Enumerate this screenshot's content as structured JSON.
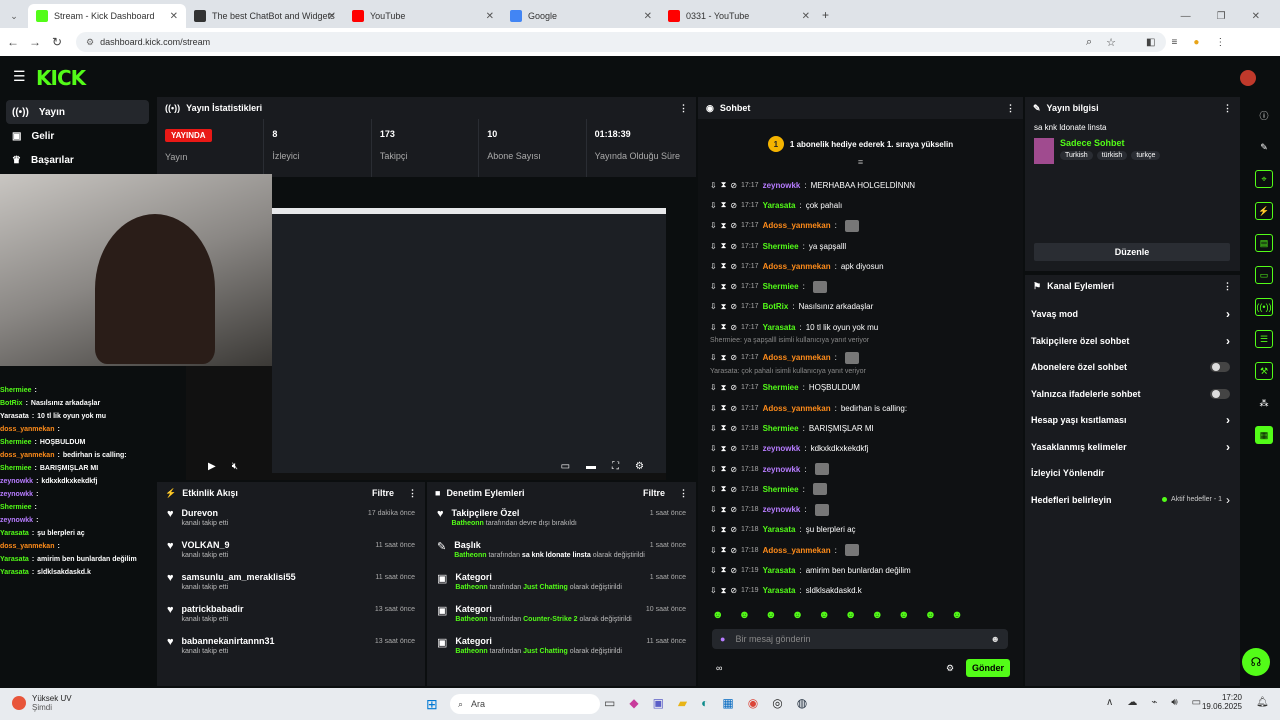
{
  "tabs": [
    {
      "label": "Stream - Kick Dashboard",
      "color": "#53fc18",
      "active": true
    },
    {
      "label": "The best ChatBot and Widgets",
      "color": "#333333"
    },
    {
      "label": "YouTube",
      "color": "#ff0000"
    },
    {
      "label": "Google",
      "color": "#4285f4"
    },
    {
      "label": "0331 - YouTube",
      "color": "#ff0000"
    }
  ],
  "url": "dashboard.kick.com/stream",
  "logo": "KICK",
  "sidebar": {
    "items": [
      {
        "label": "Yayın",
        "icon": "broadcast-icon"
      },
      {
        "label": "Gelir",
        "icon": "money-icon"
      },
      {
        "label": "Başarılar",
        "icon": "trophy-icon"
      }
    ]
  },
  "stats": {
    "title": "Yayın İstatistikleri",
    "live": "YAYINDA",
    "live_label": "Yayın",
    "items": [
      {
        "v": "8",
        "k": "İzleyici"
      },
      {
        "v": "173",
        "k": "Takipçi"
      },
      {
        "v": "10",
        "k": "Abone Sayısı"
      },
      {
        "v": "01:18:39",
        "k": "Yayında Olduğu Süre"
      }
    ]
  },
  "overlay_chat": [
    {
      "u": "Shermiee",
      "c": "#53fc18",
      "m": ""
    },
    {
      "u": "BotRix",
      "c": "#53fc18",
      "m": "Nasılsınız arkadaşlar"
    },
    {
      "u": "Yarasata",
      "c": "#ffffff",
      "m": "10 tl lik oyun yok mu"
    },
    {
      "u": "doss_yanmekan",
      "c": "#ff8c1a",
      "m": ""
    },
    {
      "u": "Shermiee",
      "c": "#53fc18",
      "m": "HOŞBULDUM"
    },
    {
      "u": "doss_yanmekan",
      "c": "#ff8c1a",
      "m": "bedirhan is calling:"
    },
    {
      "u": "Shermiee",
      "c": "#53fc18",
      "m": "BARIŞMIŞLAR MI"
    },
    {
      "u": "zeynowkk",
      "c": "#b77cff",
      "m": "kdkxkdkxkekdkfj"
    },
    {
      "u": "zeynowkk",
      "c": "#b77cff",
      "m": ""
    },
    {
      "u": "Shermiee",
      "c": "#53fc18",
      "m": ""
    },
    {
      "u": "zeynowkk",
      "c": "#b77cff",
      "m": ""
    },
    {
      "u": "Yarasata",
      "c": "#53fc18",
      "m": "şu blerpleri aç"
    },
    {
      "u": "doss_yanmekan",
      "c": "#ff8c1a",
      "m": ""
    },
    {
      "u": "Yarasata",
      "c": "#53fc18",
      "m": "amirim ben bunlardan değilim"
    },
    {
      "u": "Yarasata",
      "c": "#53fc18",
      "m": "sldklsakdaskd.k"
    }
  ],
  "activity": {
    "title": "Etkinlik Akışı",
    "filter": "Filtre",
    "rows": [
      {
        "n": "Durevon",
        "s": "kanalı takip etti",
        "t": "17 dakika önce"
      },
      {
        "n": "VOLKAN_9",
        "s": "kanalı takip etti",
        "t": "11 saat önce"
      },
      {
        "n": "samsunlu_am_meraklisi55",
        "s": "kanalı takip etti",
        "t": "11 saat önce"
      },
      {
        "n": "patrickbabadir",
        "s": "kanalı takip etti",
        "t": "13 saat önce"
      },
      {
        "n": "babannekanirtannn31",
        "s": "kanalı takip etti",
        "t": "13 saat önce"
      }
    ]
  },
  "moderation": {
    "title": "Denetim Eylemleri",
    "filter": "Filtre",
    "rows": [
      {
        "n": "Takipçilere Özel",
        "a": "Batheonn",
        "s": " tarafından devre dışı bırakıldı",
        "h": "",
        "e": "",
        "t": "1 saat önce",
        "icon": "heart-icon"
      },
      {
        "n": "Başlık",
        "a": "Batheonn",
        "s": " tarafından ",
        "h": "sa knk ldonate linsta",
        "e": " olarak değiştirildi",
        "t": "1 saat önce",
        "icon": "pencil-icon"
      },
      {
        "n": "Kategori",
        "a": "Batheonn",
        "s": " tarafından ",
        "h": "Just Chatting",
        "e": " olarak değiştirildi",
        "t": "1 saat önce",
        "icon": "category-icon"
      },
      {
        "n": "Kategori",
        "a": "Batheonn",
        "s": " tarafından ",
        "h": "Counter-Strike 2",
        "e": " olarak değiştirildi",
        "t": "10 saat önce",
        "icon": "category-icon"
      },
      {
        "n": "Kategori",
        "a": "Batheonn",
        "s": " tarafından ",
        "h": "Just Chatting",
        "e": " olarak değiştirildi",
        "t": "11 saat önce",
        "icon": "category-icon"
      }
    ]
  },
  "chat": {
    "title": "Sohbet",
    "pinned": "1 abonelik hediye ederek 1. sıraya yükselin",
    "placeholder": "Bir mesaj gönderin",
    "send": "Gönder",
    "messages": [
      {
        "t": "17:17",
        "u": "zeynowkk",
        "c": "#b77cff",
        "m": "MERHABAA HOLGELDİNNN"
      },
      {
        "t": "17:17",
        "u": "Yarasata",
        "c": "#53fc18",
        "m": "çok pahalı"
      },
      {
        "t": "17:17",
        "u": "Adoss_yanmekan",
        "c": "#ff8c1a",
        "m": ""
      },
      {
        "t": "17:17",
        "u": "Shermiee",
        "c": "#53fc18",
        "m": "ya şapşalll"
      },
      {
        "t": "17:17",
        "u": "Adoss_yanmekan",
        "c": "#ff8c1a",
        "m": "apk diyosun"
      },
      {
        "t": "17:17",
        "u": "Shermiee",
        "c": "#53fc18",
        "m": ""
      },
      {
        "t": "17:17",
        "u": "BotRix",
        "c": "#53fc18",
        "m": "Nasılsınız arkadaşlar"
      },
      {
        "t": "17:17",
        "u": "Yarasata",
        "c": "#53fc18",
        "m": "10 tl lik oyun yok mu"
      },
      {
        "reply": "Shermiee: ya şapşalll isimli kullanıcıya yanıt veriyor"
      },
      {
        "t": "17:17",
        "u": "Adoss_yanmekan",
        "c": "#ff8c1a",
        "m": ""
      },
      {
        "reply": "Yarasata: çok pahalı isimli kullanıcıya yanıt veriyor"
      },
      {
        "t": "17:17",
        "u": "Shermiee",
        "c": "#53fc18",
        "m": "HOŞBULDUM"
      },
      {
        "t": "17:17",
        "u": "Adoss_yanmekan",
        "c": "#ff8c1a",
        "m": "bedirhan is calling:"
      },
      {
        "t": "17:18",
        "u": "Shermiee",
        "c": "#53fc18",
        "m": "BARIŞMIŞLAR MI"
      },
      {
        "t": "17:18",
        "u": "zeynowkk",
        "c": "#b77cff",
        "m": "kdkxkdkxkekdkfj"
      },
      {
        "t": "17:18",
        "u": "zeynowkk",
        "c": "#b77cff",
        "m": ""
      },
      {
        "t": "17:18",
        "u": "Shermiee",
        "c": "#53fc18",
        "m": ""
      },
      {
        "t": "17:18",
        "u": "zeynowkk",
        "c": "#b77cff",
        "m": ""
      },
      {
        "t": "17:18",
        "u": "Yarasata",
        "c": "#53fc18",
        "m": "şu blerpleri aç"
      },
      {
        "t": "17:18",
        "u": "Adoss_yanmekan",
        "c": "#ff8c1a",
        "m": ""
      },
      {
        "t": "17:19",
        "u": "Yarasata",
        "c": "#53fc18",
        "m": "amirim ben bunlardan değilim"
      },
      {
        "t": "17:19",
        "u": "Yarasata",
        "c": "#53fc18",
        "m": "sldklsakdaskd.k"
      }
    ]
  },
  "info": {
    "title": "Yayın bilgisi",
    "stream_title": "sa knk ldonate linsta",
    "category": "Sadece Sohbet",
    "tags": [
      "Turkish",
      "türkish",
      "turkçe"
    ],
    "edit": "Düzenle"
  },
  "channel_actions": {
    "title": "Kanal Eylemleri",
    "rows": [
      {
        "l": "Yavaş mod",
        "k": "chevron"
      },
      {
        "l": "Takipçilere özel sohbet",
        "k": "chevron"
      },
      {
        "l": "Abonelere özel sohbet",
        "k": "toggle"
      },
      {
        "l": "Yalnızca ifadelerle sohbet",
        "k": "toggle"
      },
      {
        "l": "Hesap yaşı kısıtlaması",
        "k": "chevron"
      },
      {
        "l": "Yasaklanmış kelimeler",
        "k": "chevron"
      },
      {
        "l": "İzleyici Yönlendir",
        "k": "none"
      },
      {
        "l": "Hedefleri belirleyin",
        "k": "goal"
      }
    ],
    "goal_text": "Aktif hedefler - 1"
  },
  "taskbar": {
    "weather": "Yüksek UV",
    "weather_sub": "Şimdi",
    "search": "Ara",
    "time": "17:20",
    "date": "19.06.2025"
  },
  "colors": {
    "accent": "#53fc18",
    "panel": "#191b1f",
    "bg": "#0b0e0f"
  }
}
